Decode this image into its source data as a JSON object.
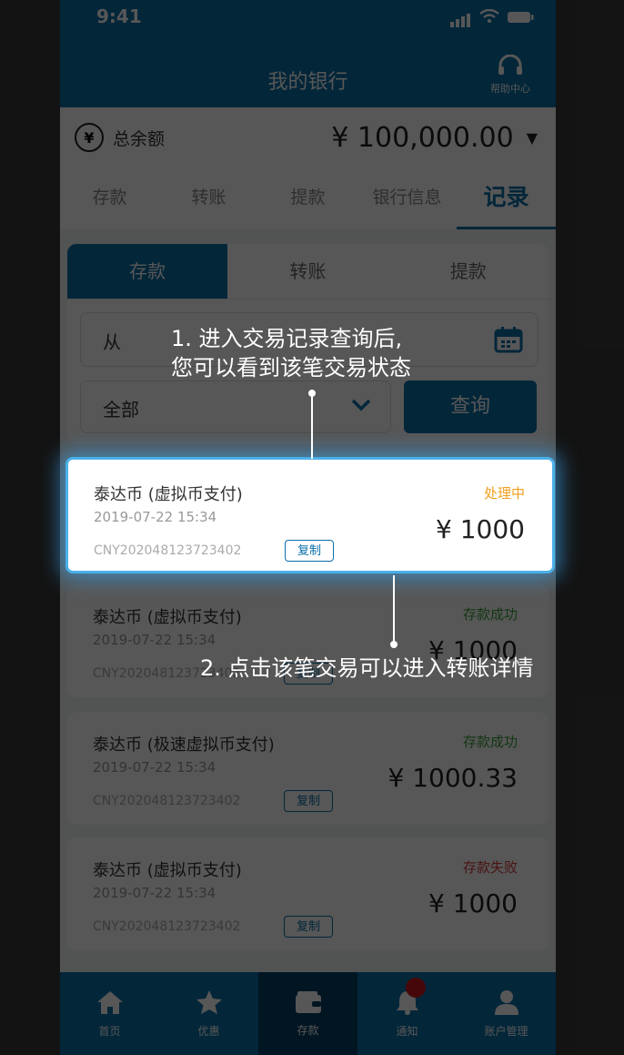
{
  "status_bar": {
    "time": "9:41"
  },
  "header": {
    "title": "我的银行",
    "help_label": "帮助中心"
  },
  "balance": {
    "label": "总余额",
    "currency_symbol": "¥",
    "amount": "¥ 100,000.00"
  },
  "main_tabs": [
    {
      "label": "存款",
      "active": false
    },
    {
      "label": "转账",
      "active": false
    },
    {
      "label": "提款",
      "active": false
    },
    {
      "label": "银行信息",
      "active": false
    },
    {
      "label": "记录",
      "active": true
    }
  ],
  "sub_tabs": [
    {
      "label": "存款",
      "active": true
    },
    {
      "label": "转账",
      "active": false
    },
    {
      "label": "提款",
      "active": false
    }
  ],
  "filter": {
    "from_label": "从",
    "type_label": "全部",
    "query_label": "查询"
  },
  "transactions": [
    {
      "name": "泰达币 (虚拟币支付)",
      "date": "2019-07-22 15:34",
      "id": "CNY202048123723402",
      "copy_label": "复制",
      "status": "处理中",
      "status_type": "processing",
      "amount": "¥ 1000"
    },
    {
      "name": "泰达币 (虚拟币支付)",
      "date": "2019-07-22 15:34",
      "id": "CNY202048123723402",
      "copy_label": "复制",
      "status": "存款成功",
      "status_type": "success",
      "amount": "¥ 1000"
    },
    {
      "name": "泰达币 (极速虚拟币支付)",
      "date": "2019-07-22 15:34",
      "id": "CNY202048123723402",
      "copy_label": "复制",
      "status": "存款成功",
      "status_type": "success",
      "amount": "¥ 1000.33"
    },
    {
      "name": "泰达币 (虚拟币支付)",
      "date": "2019-07-22 15:34",
      "id": "CNY202048123723402",
      "copy_label": "复制",
      "status": "存款失败",
      "status_type": "fail",
      "amount": "¥ 1000"
    }
  ],
  "bottom_nav": [
    {
      "label": "首页",
      "icon": "home-icon",
      "active": false
    },
    {
      "label": "优惠",
      "icon": "star-icon",
      "active": false
    },
    {
      "label": "存款",
      "icon": "wallet-icon",
      "active": true
    },
    {
      "label": "通知",
      "icon": "bell-icon",
      "active": false
    },
    {
      "label": "账户管理",
      "icon": "user-icon",
      "active": false
    }
  ],
  "callouts": {
    "step1_line1": "1. 进入交易记录查询后,",
    "step1_line2": "您可以看到该笔交易状态",
    "step2": "2. 点击该笔交易可以进入转账详情"
  },
  "colors": {
    "primary": "#0a6fa8",
    "processing": "#f0a020",
    "success": "#3aa03a",
    "fail": "#d93a3a",
    "highlight_glow": "#4cb0e8"
  }
}
